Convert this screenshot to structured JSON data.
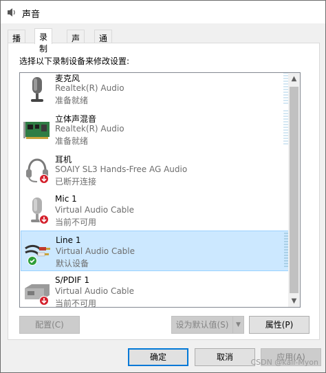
{
  "window": {
    "title": "声音",
    "icon": "speaker-icon"
  },
  "tabs": [
    {
      "label": "播放",
      "active": false
    },
    {
      "label": "录制",
      "active": true
    },
    {
      "label": "声音",
      "active": false
    },
    {
      "label": "通信",
      "active": false
    }
  ],
  "panel": {
    "instruction": "选择以下录制设备来修改设置:"
  },
  "devices": [
    {
      "name": "麦克风",
      "driver": "Realtek(R) Audio",
      "status": "准备就绪",
      "icon": "microphone-icon",
      "badge": "",
      "selected": false
    },
    {
      "name": "立体声混音",
      "driver": "Realtek(R) Audio",
      "status": "准备就绪",
      "icon": "sound-card-icon",
      "badge": "",
      "selected": false
    },
    {
      "name": "耳机",
      "driver": "SOAIY SL3 Hands-Free AG Audio",
      "status": "已断开连接",
      "icon": "headset-icon",
      "badge": "down-arrow-badge",
      "selected": false
    },
    {
      "name": "Mic 1",
      "driver": "Virtual Audio Cable",
      "status": "当前不可用",
      "icon": "microphone-icon",
      "badge": "down-arrow-badge",
      "selected": false
    },
    {
      "name": "Line 1",
      "driver": "Virtual Audio Cable",
      "status": "默认设备",
      "icon": "line-in-cable-icon",
      "badge": "default-check-badge",
      "selected": true
    },
    {
      "name": "S/PDIF 1",
      "driver": "Virtual Audio Cable",
      "status": "当前不可用",
      "icon": "spdif-device-icon",
      "badge": "down-arrow-badge",
      "selected": false
    }
  ],
  "buttons": {
    "configure": "配置(C)",
    "set_default": "设为默认值(S)",
    "properties": "属性(P)",
    "ok": "确定",
    "cancel": "取消",
    "apply": "应用(A)"
  },
  "watermark": "CSDN @kali-Myon",
  "colors": {
    "selection_bg": "#cce8ff",
    "selection_border": "#99d1ff",
    "default_badge": "#2e9e3a",
    "unavailable_badge": "#d4202c",
    "primary_border": "#0078d7"
  }
}
